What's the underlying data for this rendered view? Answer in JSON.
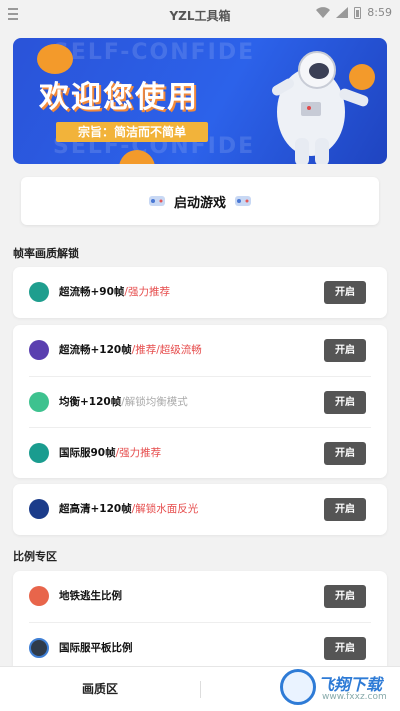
{
  "status_bar": {
    "app_title": "YZL工具箱",
    "time": "8:59"
  },
  "banner": {
    "ghost_text": "SELF-CONFIDE",
    "headline": "欢迎您使用",
    "tagline": "宗旨：简洁而不简单"
  },
  "launch": {
    "label": "启动游戏"
  },
  "sections": {
    "frame_title": "帧率画质解锁",
    "ratio_title": "比例专区"
  },
  "cards": [
    {
      "rows": [
        {
          "main": "超流畅+90帧",
          "sub": "/强力推荐",
          "sub_color": "#e64d4d",
          "icon_color": "#1f9e8e",
          "button": "开启"
        }
      ]
    },
    {
      "rows": [
        {
          "main": "超流畅+120帧",
          "sub": "/推荐/超级流畅",
          "sub_color": "#e64d4d",
          "icon_color": "#5a3fb0",
          "button": "开启"
        },
        {
          "main": "均衡+120帧",
          "sub": "/解锁均衡模式",
          "sub_color": "#aaaaaa",
          "icon_color": "#3ec28f",
          "button": "开启"
        },
        {
          "main": "国际服90帧",
          "sub": "/强力推荐",
          "sub_color": "#e64d4d",
          "icon_color": "#1a9c8f",
          "button": "开启"
        }
      ]
    },
    {
      "rows": [
        {
          "main": "超高清+120帧",
          "sub": "/解锁水面反光",
          "sub_color": "#e64d4d",
          "icon_color": "#1b3c8a",
          "button": "开启"
        }
      ]
    },
    {
      "rows": [
        {
          "main": "地铁逃生比例",
          "sub": "",
          "sub_color": "#e64d4d",
          "icon_color": "#e8654b",
          "button": "开启"
        },
        {
          "main": "国际服平板比例",
          "sub": "",
          "sub_color": "#e64d4d",
          "icon_color": "#2f3b4a",
          "button": "开启"
        }
      ]
    }
  ],
  "tabbar": {
    "tab_quality": "画质区"
  },
  "watermark": {
    "text": "飞翔下载",
    "url": "www.fxxz.com"
  }
}
